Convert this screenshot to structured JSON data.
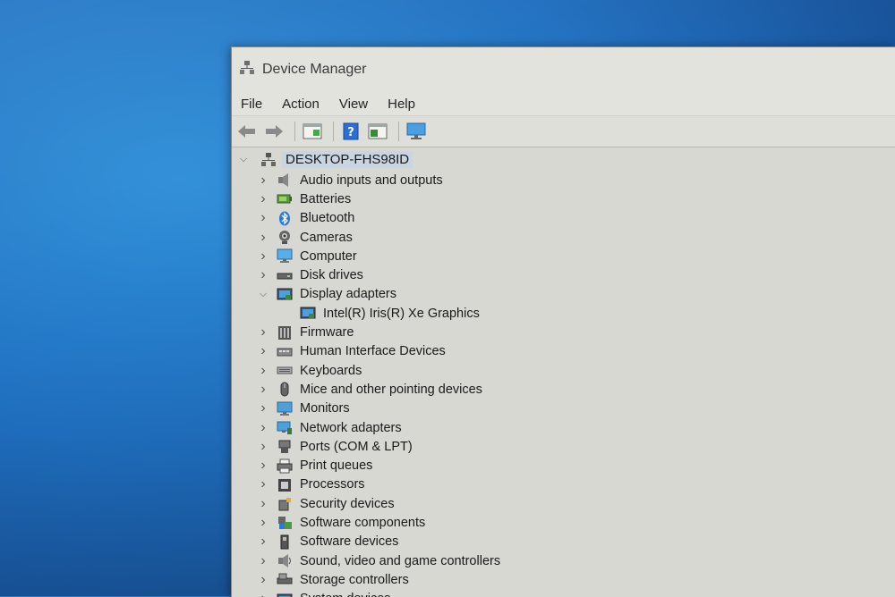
{
  "window": {
    "title": "Device Manager"
  },
  "menu": {
    "items": [
      "File",
      "Action",
      "View",
      "Help"
    ]
  },
  "toolbar": {
    "buttons": [
      "back-arrow-icon",
      "forward-arrow-icon",
      "properties-icon",
      "help-icon",
      "details-icon",
      "monitor-scan-icon"
    ]
  },
  "tree": {
    "root": {
      "label": "DESKTOP-FHS98ID",
      "expanded": true
    },
    "categories": [
      {
        "label": "Audio inputs and outputs",
        "icon": "speaker-icon",
        "expanded": false
      },
      {
        "label": "Batteries",
        "icon": "battery-icon",
        "expanded": false
      },
      {
        "label": "Bluetooth",
        "icon": "bluetooth-icon",
        "expanded": false
      },
      {
        "label": "Cameras",
        "icon": "camera-icon",
        "expanded": false
      },
      {
        "label": "Computer",
        "icon": "computer-icon",
        "expanded": false
      },
      {
        "label": "Disk drives",
        "icon": "disk-drive-icon",
        "expanded": false
      },
      {
        "label": "Display adapters",
        "icon": "display-adapter-icon",
        "expanded": true,
        "children": [
          {
            "label": "Intel(R) Iris(R) Xe Graphics",
            "icon": "display-adapter-icon"
          }
        ]
      },
      {
        "label": "Firmware",
        "icon": "firmware-icon",
        "expanded": false
      },
      {
        "label": "Human Interface Devices",
        "icon": "hid-icon",
        "expanded": false
      },
      {
        "label": "Keyboards",
        "icon": "keyboard-icon",
        "expanded": false
      },
      {
        "label": "Mice and other pointing devices",
        "icon": "mouse-icon",
        "expanded": false
      },
      {
        "label": "Monitors",
        "icon": "monitor-icon",
        "expanded": false
      },
      {
        "label": "Network adapters",
        "icon": "network-adapter-icon",
        "expanded": false
      },
      {
        "label": "Ports (COM & LPT)",
        "icon": "port-icon",
        "expanded": false
      },
      {
        "label": "Print queues",
        "icon": "printer-icon",
        "expanded": false
      },
      {
        "label": "Processors",
        "icon": "processor-icon",
        "expanded": false
      },
      {
        "label": "Security devices",
        "icon": "security-device-icon",
        "expanded": false
      },
      {
        "label": "Software components",
        "icon": "software-component-icon",
        "expanded": false
      },
      {
        "label": "Software devices",
        "icon": "software-device-icon",
        "expanded": false
      },
      {
        "label": "Sound, video and game controllers",
        "icon": "sound-controller-icon",
        "expanded": false
      },
      {
        "label": "Storage controllers",
        "icon": "storage-controller-icon",
        "expanded": false
      },
      {
        "label": "System devices",
        "icon": "system-device-icon",
        "expanded": false
      }
    ]
  },
  "colors": {
    "desktop": "#1f6fc0",
    "window_bg": "#d8d8d2",
    "selection": "#c9d5e3",
    "accent": "#2b7bd4"
  }
}
